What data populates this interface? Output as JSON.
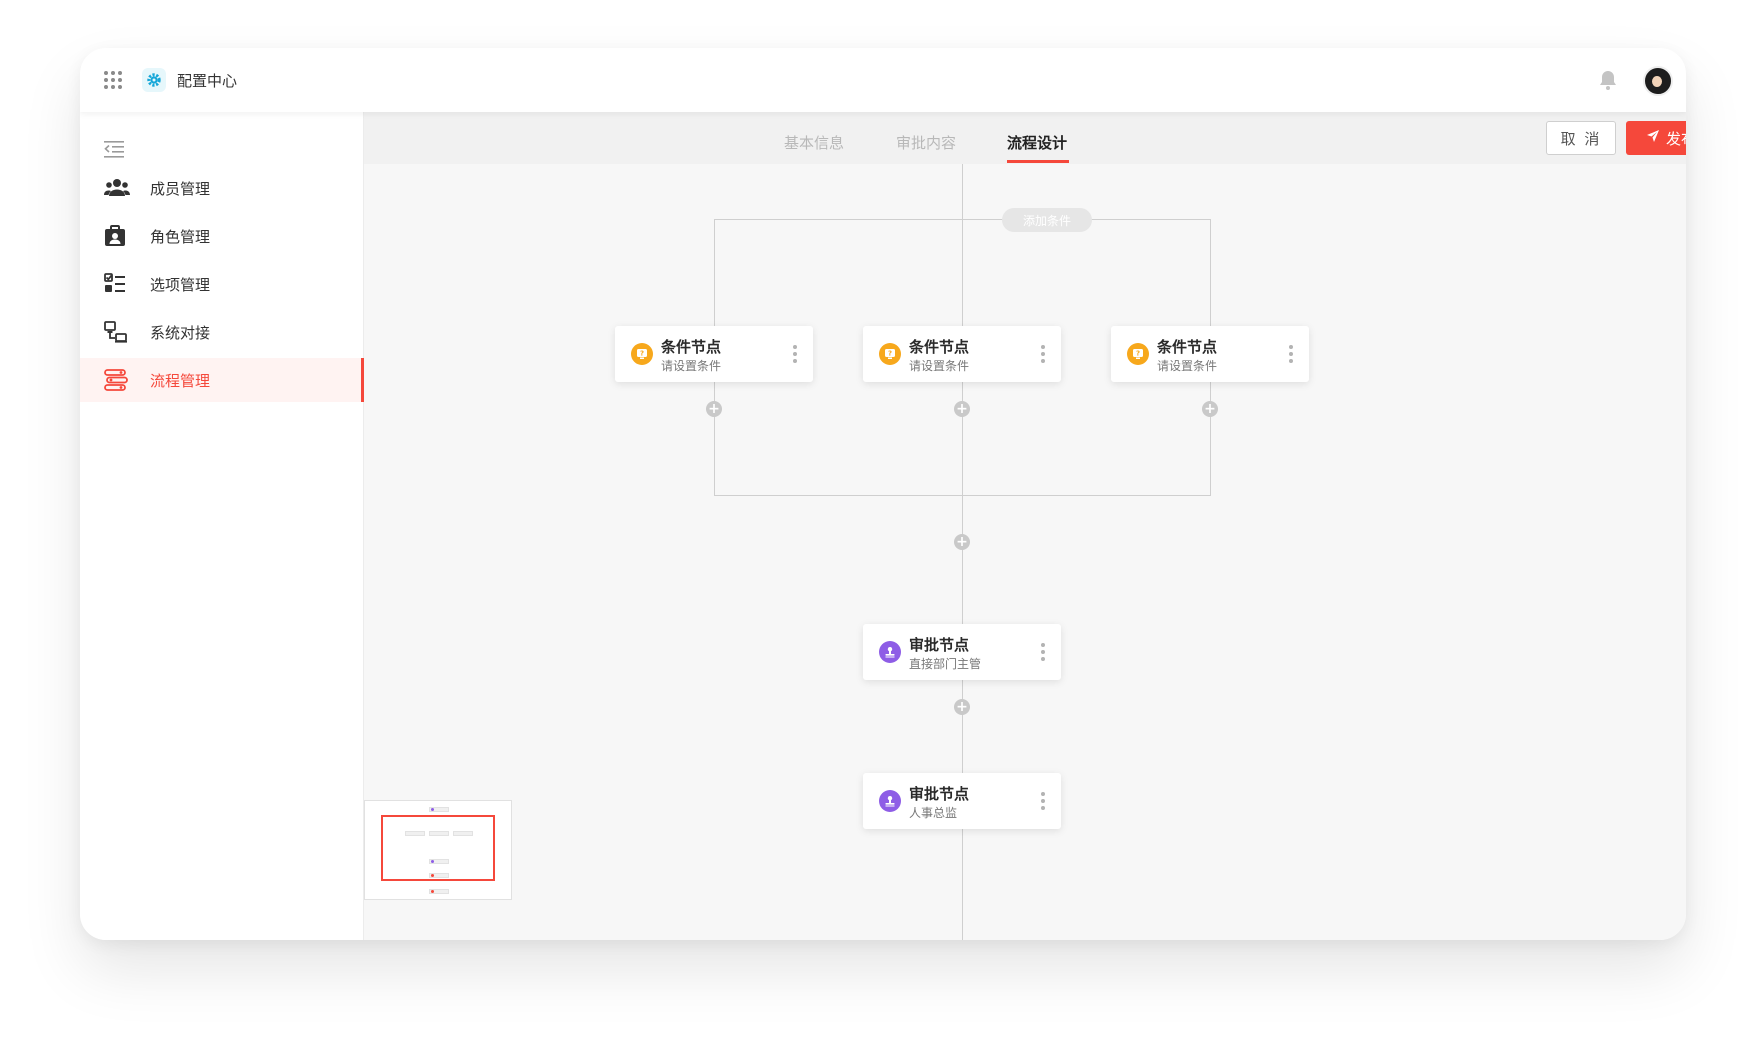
{
  "app": {
    "title": "配置中心",
    "icons": {
      "apps": "apps-grid-icon",
      "logo": "gear-icon",
      "notifications": "bell-icon",
      "avatar": "user-avatar"
    },
    "accent_color": "#f5483b"
  },
  "sidebar": {
    "collapse_icon": "menu-collapse-icon",
    "items": [
      {
        "label": "成员管理",
        "icon": "members-icon",
        "active": false
      },
      {
        "label": "角色管理",
        "icon": "role-badge-icon",
        "active": false
      },
      {
        "label": "选项管理",
        "icon": "checklist-icon",
        "active": false
      },
      {
        "label": "系统对接",
        "icon": "system-link-icon",
        "active": false
      },
      {
        "label": "流程管理",
        "icon": "flow-icon",
        "active": true
      }
    ]
  },
  "tabs": [
    {
      "label": "基本信息",
      "active": false
    },
    {
      "label": "审批内容",
      "active": false
    },
    {
      "label": "流程设计",
      "active": true
    }
  ],
  "actions": {
    "cancel_label": "取 消",
    "publish_label": "发布流程",
    "publish_icon": "send-icon"
  },
  "canvas": {
    "add_condition_label": "添加条件",
    "condition_nodes": [
      {
        "title": "条件节点",
        "subtitle": "请设置条件",
        "icon": "condition-icon",
        "color": "#f7a81c"
      },
      {
        "title": "条件节点",
        "subtitle": "请设置条件",
        "icon": "condition-icon",
        "color": "#f7a81c"
      },
      {
        "title": "条件节点",
        "subtitle": "请设置条件",
        "icon": "condition-icon",
        "color": "#f7a81c"
      }
    ],
    "approval_nodes": [
      {
        "title": "审批节点",
        "subtitle": "直接部门主管",
        "icon": "stamp-icon",
        "color": "#8e5de6"
      },
      {
        "title": "审批节点",
        "subtitle": "人事总监",
        "icon": "stamp-icon",
        "color": "#8e5de6"
      }
    ],
    "add_node_icon": "plus-circle-icon",
    "more_icon": "more-vertical-icon"
  }
}
